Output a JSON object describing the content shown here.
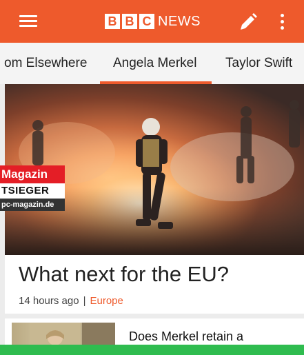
{
  "app": {
    "logo_letters": [
      "B",
      "B",
      "C"
    ],
    "logo_word": "NEWS",
    "brand_color": "#ee5a2c",
    "icons": {
      "menu": "hamburger-menu-icon",
      "edit": "pencil-icon",
      "more": "kebab-menu-icon"
    }
  },
  "tabs": [
    {
      "label": "om Elsewhere",
      "selected": false
    },
    {
      "label": "Angela Merkel",
      "selected": true
    },
    {
      "label": "Taylor Swift",
      "selected": false
    }
  ],
  "watermark": {
    "line1": "Magazin",
    "line2": "TSIEGER",
    "line3": "pc-magazin.de"
  },
  "article": {
    "headline": "What next for the EU?",
    "time": "14 hours ago",
    "separator": "|",
    "category": "Europe"
  },
  "next_article": {
    "title": "Does Merkel retain a"
  },
  "colors": {
    "accent": "#ee5a2c",
    "bottom_bar": "#2fbc4f"
  }
}
